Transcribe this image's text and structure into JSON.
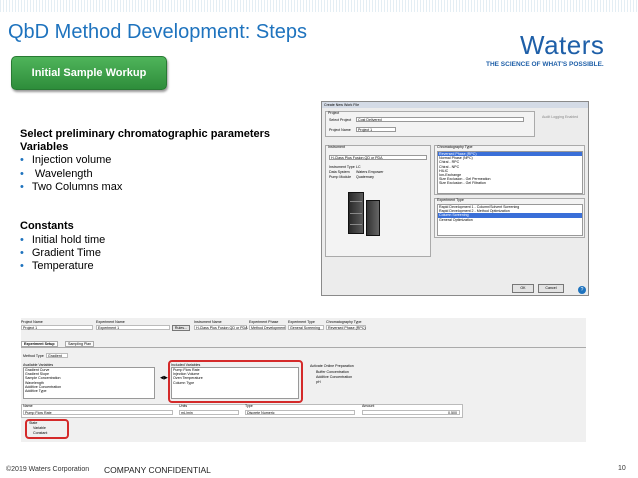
{
  "slide": {
    "title": "QbD Method Development: Steps",
    "logo": "Waters",
    "tagline": "THE SCIENCE OF WHAT'S POSSIBLE.",
    "step_badge": "Initial Sample Workup",
    "params_heading": "Select preliminary chromatographic parameters",
    "variables_heading": "Variables",
    "variables": [
      "Injection volume",
      "Wavelength",
      "Two Columns max"
    ],
    "constants_heading": "Constants",
    "constants": [
      "Initial hold time",
      "Gradient Time",
      "Temperature"
    ],
    "bullet": "•",
    "footer_copyright": "©2019 Waters Corporation",
    "footer_confidential": "COMPANY CONFIDENTIAL",
    "page_number": "10"
  },
  "dialog": {
    "title": "Create New Work File",
    "project_group": "Project",
    "select_project_label": "Select Project",
    "select_project_value": "Cost Delivered",
    "audit_label": "Audit Logging Enabled",
    "project_name_label": "Project Name",
    "project_name_value": "Project 1",
    "instrument_group": "Instrument",
    "instrument_value": "H-Class Plus Fusion QD or PDA",
    "instrument_type_label": "Instrument Type",
    "instrument_type_value": "LC",
    "data_system_label": "Data System",
    "data_system_value": "Waters Empower",
    "pump_module_label": "Pump Module",
    "pump_module_value": "Quaternary",
    "chrom_type_group": "Chromatography Type",
    "chrom_types": [
      "Reversed Phase (RPC)",
      "Normal Phase (NPC)",
      "Chiral - RPC",
      "Chiral - NPC",
      "HILIC",
      "Ion-Exchange",
      "Size Exclusion - Gel Permeation",
      "Size Exclusion - Gel Filtration"
    ],
    "experiment_type_group": "Experiment Type",
    "experiment_types": [
      "Rapid Development 1 - Column/Solvent Screening",
      "Rapid Development 2 - Method Optimization",
      "Column Screening",
      "General Optimization"
    ],
    "ok_label": "OK",
    "cancel_label": "Cancel",
    "help_label": "?"
  },
  "editor": {
    "headers": [
      "Project Name",
      "Experiment Name",
      "Instrument Name",
      "Experiment Phase",
      "Experiment Type",
      "Chromatography Type"
    ],
    "values": [
      "Project 1",
      "Experiment 1",
      "H-Class Plus Fusion QD or PDA",
      "Method Development",
      "General Screening",
      "Reversed Phase (RPC)"
    ],
    "rules_label": "Rules...",
    "tabs": [
      "Experiment Setup",
      "Sampling Plan"
    ],
    "method_type_label": "Method Type",
    "method_type_value": "Gradient",
    "available_label": "Available Variables",
    "available_variables": [
      "Gradient Curve",
      "Gradient Slope",
      "Sample Concentration",
      "Wavelength",
      "Additive Concentration",
      "Additive Type"
    ],
    "included_label": "Included Variables",
    "included_variables": [
      "Pump Flow Rate",
      "Injection Volume",
      "Oven Temperature",
      "Column Type"
    ],
    "move_left": "◀",
    "move_right": "▶",
    "online_prep_label": "Activate Online Preparation",
    "prep_options": [
      "Buffer Concentration",
      "Additive Concentration",
      "pH"
    ],
    "table_headers": [
      "Name",
      "Units",
      "Type",
      "Amount"
    ],
    "table_row": [
      "Pump Flow Rate",
      "mL/min",
      "Discrete Numeric",
      "0.500"
    ],
    "state_label": "State",
    "state_options": [
      "Variable",
      "Constant"
    ]
  }
}
